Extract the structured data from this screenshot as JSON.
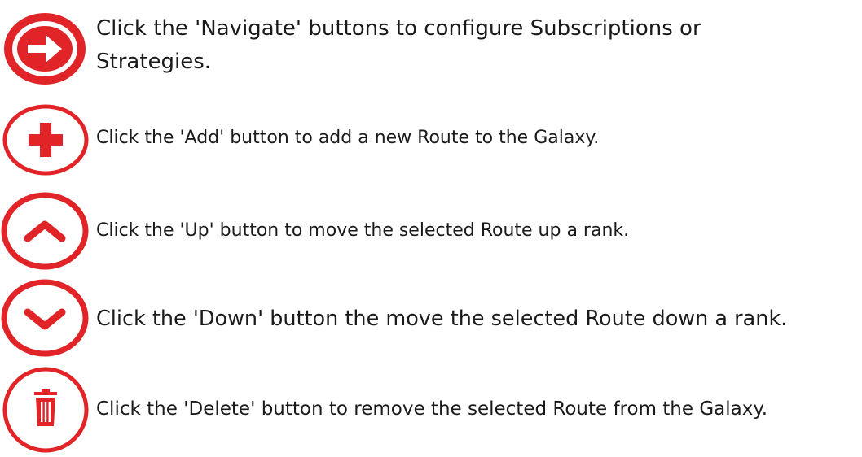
{
  "colors": {
    "accent": "#e02427"
  },
  "items": [
    {
      "icon": "arrow-right-icon",
      "text": "Click the 'Navigate' buttons to configure Subscriptions or Strategies."
    },
    {
      "icon": "plus-icon",
      "text": "Click the 'Add' button to add a new Route to the Galaxy."
    },
    {
      "icon": "chevron-up-icon",
      "text": "Click the 'Up' button to move the selected Route up a rank."
    },
    {
      "icon": "chevron-down-icon",
      "text": "Click the 'Down' button the move the selected Route down a rank."
    },
    {
      "icon": "trash-icon",
      "text": "Click the 'Delete' button to remove the selected Route from the Galaxy."
    }
  ]
}
